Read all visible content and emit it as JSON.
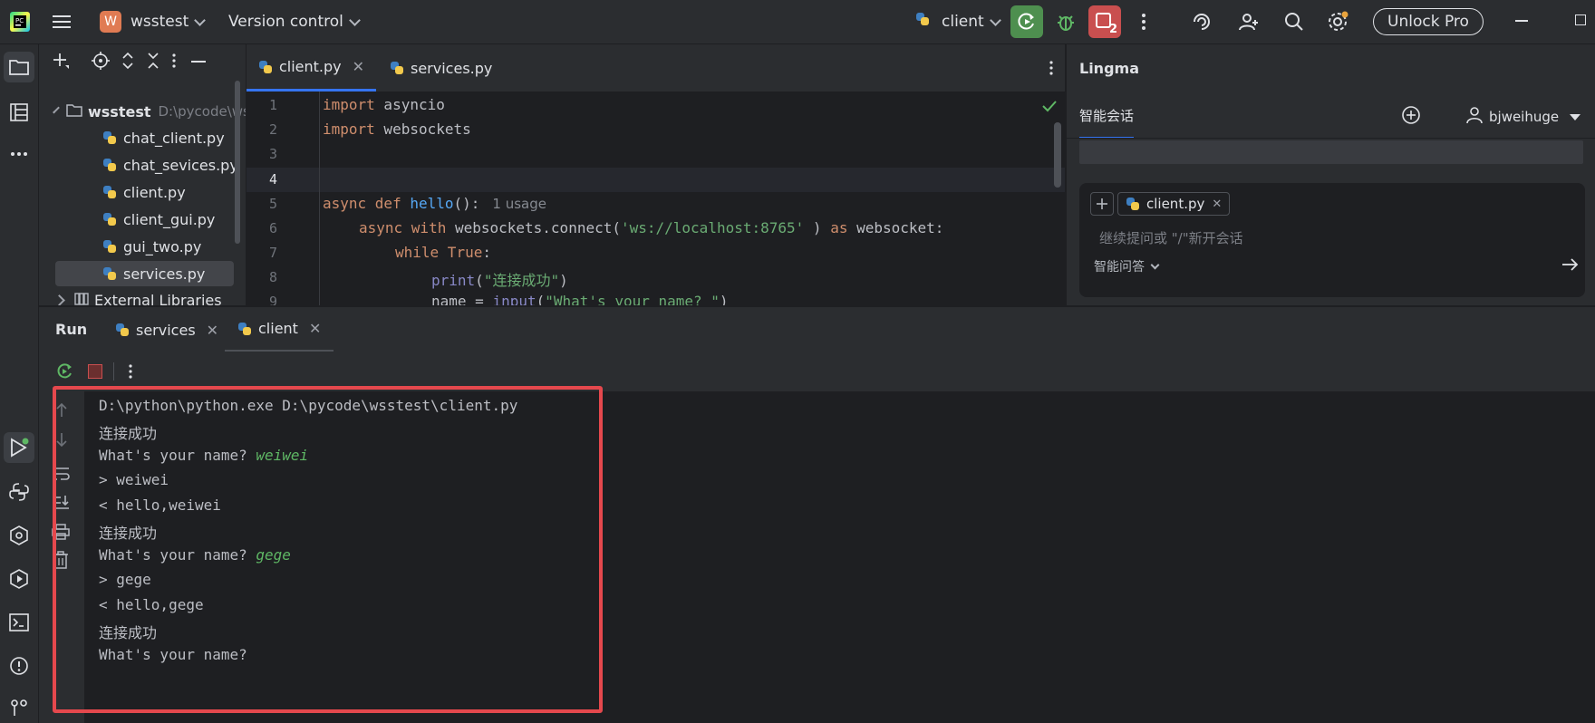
{
  "titlebar": {
    "project_badge": "W",
    "project_name": "wsstest",
    "vcs": "Version control",
    "run_config": "client",
    "stop_badge": "2",
    "unlock": "Unlock Pro",
    "colors": {
      "run_button": "#4e8f4f",
      "stop_button": "#c94f4f",
      "project_badge": "#e07b53"
    }
  },
  "project": {
    "root_name": "wsstest",
    "root_path": "D:\\pycode\\wsstest",
    "files": [
      "chat_client.py",
      "chat_sevices.py",
      "client.py",
      "client_gui.py",
      "gui_two.py",
      "services.py"
    ],
    "selected": "services.py",
    "external": "External Libraries"
  },
  "editor": {
    "tabs": [
      {
        "label": "client.py",
        "active": true
      },
      {
        "label": "services.py",
        "active": false
      }
    ],
    "line_numbers": [
      "1",
      "2",
      "3",
      "4",
      "5",
      "6",
      "7",
      "8",
      "9"
    ],
    "usage_hint": "1 usage",
    "code": {
      "l1_kw": "import",
      "l1_rest": " asyncio",
      "l2_kw": "import",
      "l2_rest": " websockets",
      "l5_kw": "async def",
      "l5_fn": "hello",
      "l5_rest": "():",
      "l6_kw1": "async with",
      "l6_mid": " websockets.connect(",
      "l6_str": "'ws://localhost:8765'",
      "l6_mid2": " ) ",
      "l6_kw2": "as",
      "l6_end": " websocket:",
      "l7_kw": "while",
      "l7_kw2": " True",
      "l7_end": ":",
      "l8_bi": "print",
      "l8_open": "(",
      "l8_str": "\"连接成功\"",
      "l8_close": ")",
      "l9_start": "name = ",
      "l9_bi": "input",
      "l9_open": "(",
      "l9_str": "\"What's your name? \"",
      "l9_close": ")"
    }
  },
  "lingma": {
    "title": "Lingma",
    "tab": "智能会话",
    "user": "bjweihuge",
    "context_file": "client.py",
    "placeholder": "继续提问或 \"/\"新开会话",
    "mode": "智能问答"
  },
  "run": {
    "title": "Run",
    "tabs": [
      {
        "label": "services",
        "active": false
      },
      {
        "label": "client",
        "active": true
      }
    ],
    "console": [
      {
        "text": "D:\\python\\python.exe D:\\pycode\\wsstest\\client.py",
        "input": ""
      },
      {
        "text": "连接成功",
        "input": ""
      },
      {
        "text": "What's your name? ",
        "input": "weiwei"
      },
      {
        "text": "> weiwei",
        "input": ""
      },
      {
        "text": "< hello,weiwei",
        "input": ""
      },
      {
        "text": "连接成功",
        "input": ""
      },
      {
        "text": "What's your name? ",
        "input": "gege"
      },
      {
        "text": "> gege",
        "input": ""
      },
      {
        "text": "< hello,gege",
        "input": ""
      },
      {
        "text": "连接成功",
        "input": ""
      },
      {
        "text": "What's your name?",
        "input": ""
      }
    ],
    "highlight_color": "#e5484d"
  }
}
